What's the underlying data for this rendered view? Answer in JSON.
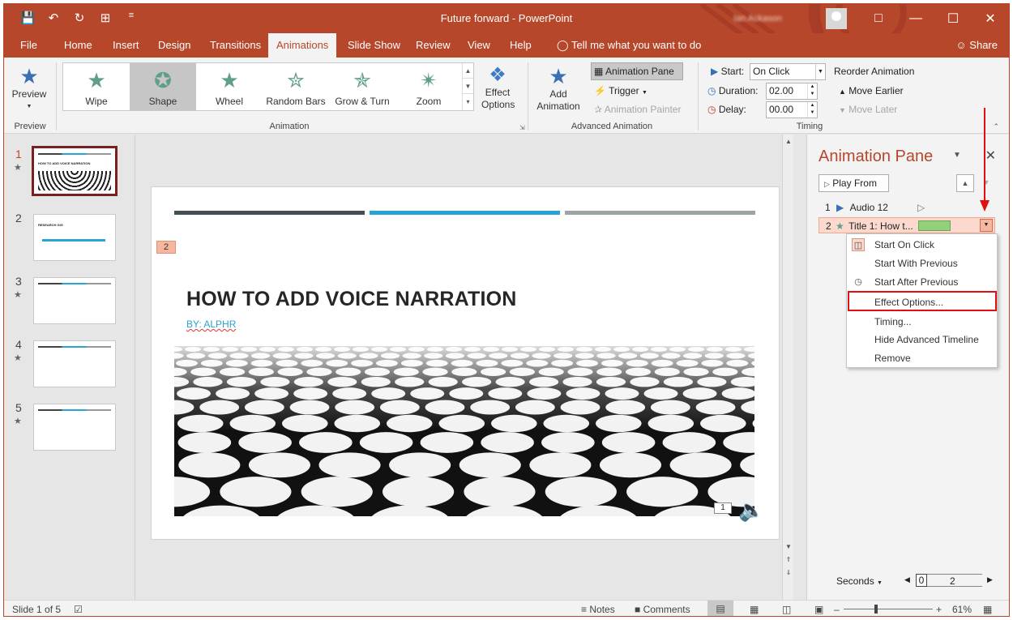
{
  "window": {
    "title": "Future forward  -  PowerPoint",
    "user": "Ian Ackason"
  },
  "qat": {
    "save": "💾",
    "undo": "↶",
    "redo": "↻",
    "present": "⊞",
    "customize": "≡"
  },
  "tabs": [
    "File",
    "Home",
    "Insert",
    "Design",
    "Transitions",
    "Animations",
    "Slide Show",
    "Review",
    "View",
    "Help"
  ],
  "tell_me": "Tell me what you want to do",
  "share": "Share",
  "ribbon": {
    "preview": {
      "label": "Preview",
      "group": "Preview"
    },
    "gallery": [
      "Wipe",
      "Shape",
      "Wheel",
      "Random Bars",
      "Grow & Turn",
      "Zoom"
    ],
    "effect_options": "Effect Options",
    "animation_group": "Animation",
    "add_animation": "Add Animation",
    "animation_pane": "Animation Pane",
    "trigger": "Trigger",
    "animation_painter": "Animation Painter",
    "advanced_group": "Advanced Animation",
    "start_label": "Start:",
    "start_value": "On Click",
    "duration_label": "Duration:",
    "duration_value": "02.00",
    "delay_label": "Delay:",
    "delay_value": "00.00",
    "reorder": "Reorder Animation",
    "move_earlier": "Move Earlier",
    "move_later": "Move Later",
    "timing_group": "Timing"
  },
  "slides": [
    {
      "num": "1",
      "star": "★"
    },
    {
      "num": "2",
      "star": ""
    },
    {
      "num": "3",
      "star": "★"
    },
    {
      "num": "4",
      "star": "★"
    },
    {
      "num": "5",
      "star": "★"
    }
  ],
  "slide": {
    "anim_tag": "2",
    "title": "HOW TO ADD VOICE NARRATION",
    "subtitle": "BY: ALPHR",
    "audio_tag": "1",
    "bar_colors": [
      "#454f56",
      "#29a3d3",
      "#9ea3a6"
    ]
  },
  "pane": {
    "title": "Animation Pane",
    "play_from": "Play From",
    "items": [
      {
        "num": "1",
        "label": "Audio 12"
      },
      {
        "num": "2",
        "label": "Title 1: How t..."
      }
    ],
    "seconds": "Seconds",
    "scale_start": "0",
    "scale_mid": "2"
  },
  "context_menu": [
    "Start On Click",
    "Start With Previous",
    "Start After Previous",
    "Effect Options...",
    "Timing...",
    "Hide Advanced Timeline",
    "Remove"
  ],
  "status": {
    "slide": "Slide 1 of 5",
    "notes": "Notes",
    "comments": "Comments",
    "zoom": "61%"
  }
}
